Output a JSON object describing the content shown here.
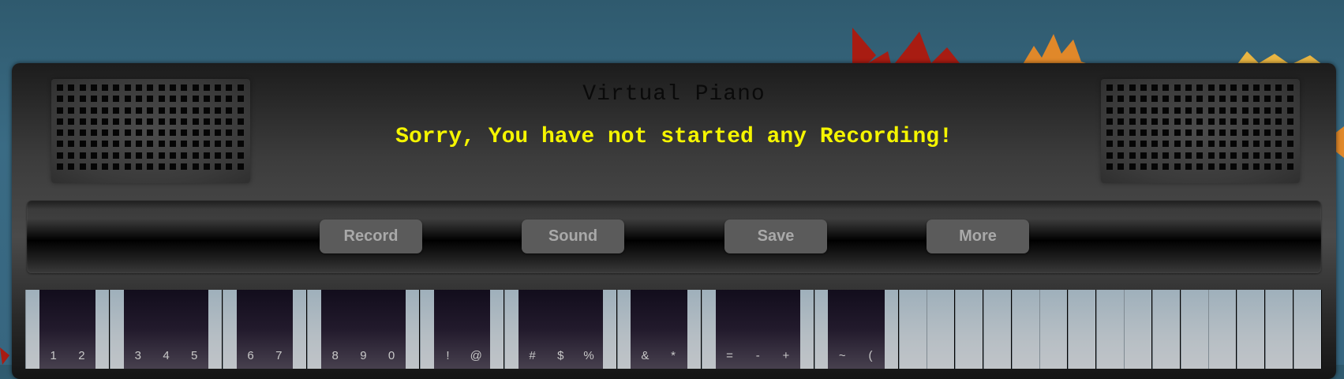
{
  "app": {
    "title": "Virtual Piano",
    "message": "Sorry, You have not started any Recording!"
  },
  "toolbar": {
    "buttons": [
      {
        "label": "Record"
      },
      {
        "label": "Sound"
      },
      {
        "label": "Save"
      },
      {
        "label": "More"
      }
    ]
  },
  "keyboard": {
    "black_keys": [
      {
        "label": "1"
      },
      {
        "label": "2"
      },
      {
        "label": "3"
      },
      {
        "label": "4"
      },
      {
        "label": "5"
      },
      {
        "label": "6"
      },
      {
        "label": "7"
      },
      {
        "label": "8"
      },
      {
        "label": "9"
      },
      {
        "label": "0"
      },
      {
        "label": "!"
      },
      {
        "label": "@"
      },
      {
        "label": "#"
      },
      {
        "label": "$"
      },
      {
        "label": "%"
      },
      {
        "label": "&"
      },
      {
        "label": "*"
      },
      {
        "label": "="
      },
      {
        "label": "-"
      },
      {
        "label": "+"
      },
      {
        "label": "~"
      },
      {
        "label": "("
      }
    ]
  },
  "colors": {
    "message": "#f5f500",
    "button_bg": "#5b5b5b",
    "button_text": "#a9a9a9"
  }
}
